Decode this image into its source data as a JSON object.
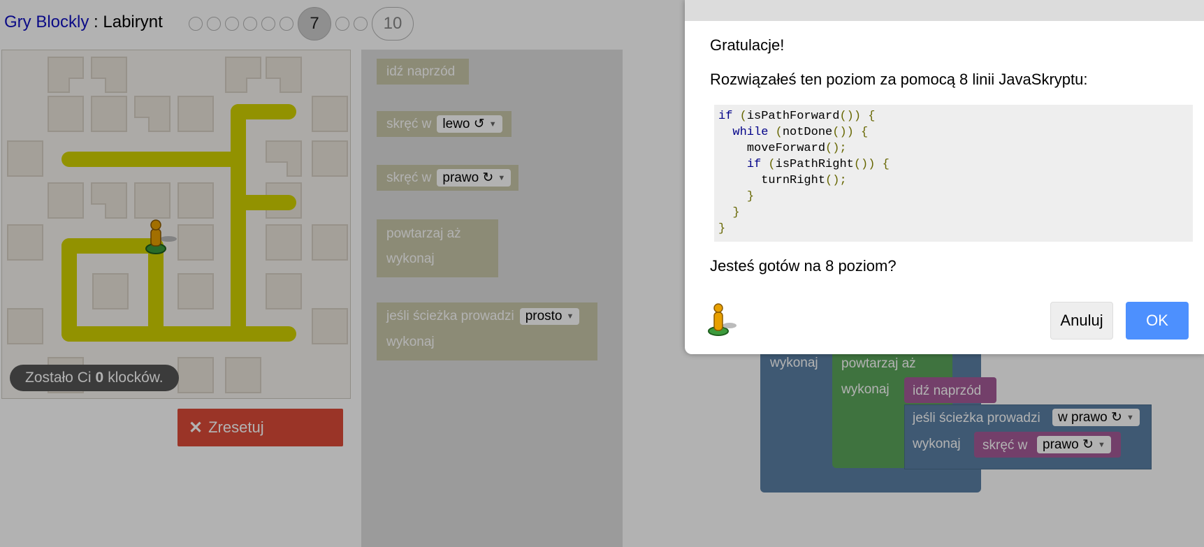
{
  "header": {
    "app_link": "Gry Blockly",
    "separator": " : ",
    "game_name": "Labirynt",
    "current_level": "7",
    "last_level": "10"
  },
  "maze": {
    "capacity_prefix": "Zostało Ci",
    "capacity_count": "0",
    "capacity_suffix": "klocków.",
    "path_color": "#d2d200",
    "pegman_color": "#e8a000"
  },
  "reset_button": {
    "label": "Zresetuj",
    "icon": "x-icon",
    "color": "#dd4b39"
  },
  "toolbox": {
    "move_forward": "idź naprzód",
    "turn_label": "skręć w",
    "turn_left_value": "lewo ↺",
    "turn_right_value": "prawo ↻",
    "repeat_until": "powtarzaj aż",
    "do_label": "wykonaj",
    "if_path": "jeśli ścieżka prowadzi",
    "if_path_value": "prosto"
  },
  "workspace": {
    "do_label": "wykonaj",
    "repeat_until": "powtarzaj aż",
    "move_forward": "idź naprzód",
    "if_path": "jeśli ścieżka prowadzi",
    "if_path_value": "w prawo ↻",
    "turn_label": "skręć w",
    "turn_value": "prawo ↻",
    "colors": {
      "logic": "#5b80a5",
      "loop": "#5ba55b",
      "movement": "#a55b99"
    }
  },
  "dialog": {
    "title": "Gratulacje!",
    "message": "Rozwiązałeś ten poziom za pomocą 8 linii JavaSkryptu:",
    "code_lines": [
      {
        "kw": "if",
        "rest": " (isPathForward()) {",
        "indent": ""
      },
      {
        "kw": "while",
        "rest": " (notDone()) {",
        "indent": "  "
      },
      {
        "kw": "",
        "rest": "moveForward();",
        "indent": "    "
      },
      {
        "kw": "if",
        "rest": " (isPathRight()) {",
        "indent": "    "
      },
      {
        "kw": "",
        "rest": "turnRight();",
        "indent": "      "
      },
      {
        "kw": "",
        "rest": "}",
        "indent": "    "
      },
      {
        "kw": "",
        "rest": "}",
        "indent": "  "
      },
      {
        "kw": "",
        "rest": "}",
        "indent": ""
      }
    ],
    "question": "Jesteś gotów na 8 poziom?",
    "cancel": "Anuluj",
    "ok": "OK",
    "ok_color": "#4d90fe"
  }
}
